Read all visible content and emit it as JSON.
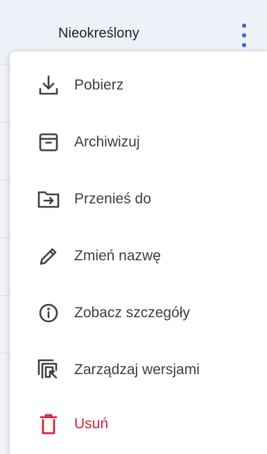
{
  "header": {
    "status": "Nieokreślony",
    "more_icon": "more-vertical-icon"
  },
  "menu": {
    "items": [
      {
        "label": "Pobierz",
        "icon": "download-icon"
      },
      {
        "label": "Archiwizuj",
        "icon": "archive-icon"
      },
      {
        "label": "Przenieś do",
        "icon": "move-to-folder-icon"
      },
      {
        "label": "Zmień nazwę",
        "icon": "pencil-icon"
      },
      {
        "label": "Zobacz szczegóły",
        "icon": "info-icon"
      },
      {
        "label": "Zarządzaj wersjami",
        "icon": "versions-icon"
      },
      {
        "label": "Usuń",
        "icon": "trash-icon"
      }
    ]
  },
  "colors": {
    "icon": "#3c4043",
    "danger": "#d6213e",
    "accent": "#3b63e0"
  }
}
